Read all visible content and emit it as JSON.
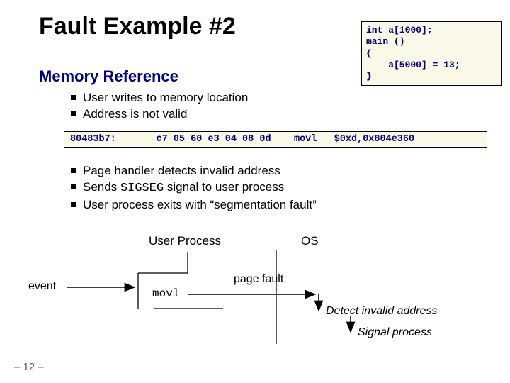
{
  "title": "Fault Example #2",
  "section": "Memory Reference",
  "code": {
    "l1": "int a[1000];",
    "l2": "main ()",
    "l3": "{",
    "l4": "    a[5000] = 13;",
    "l5": "}"
  },
  "bullets_a": {
    "b0": "User writes to memory location",
    "b1": "Address is not valid"
  },
  "dump": {
    "addr": "80483b7:",
    "bytes": "c7 05 60 e3 04 08 0d",
    "mnem": "movl",
    "ops": "$0xd,0x804e360"
  },
  "bullets_b": {
    "b0": "Page handler detects invalid address",
    "b1_pre": "Sends ",
    "b1_sig": "SIGSEG",
    "b1_post": " signal to user process",
    "b2": "User process exits with “segmentation fault”"
  },
  "diagram": {
    "user_process": "User Process",
    "os": "OS",
    "event": "event",
    "movl": "movl",
    "page_fault": "page fault",
    "detect": "Detect invalid address",
    "signal": "Signal process"
  },
  "footer": "– 12 –"
}
